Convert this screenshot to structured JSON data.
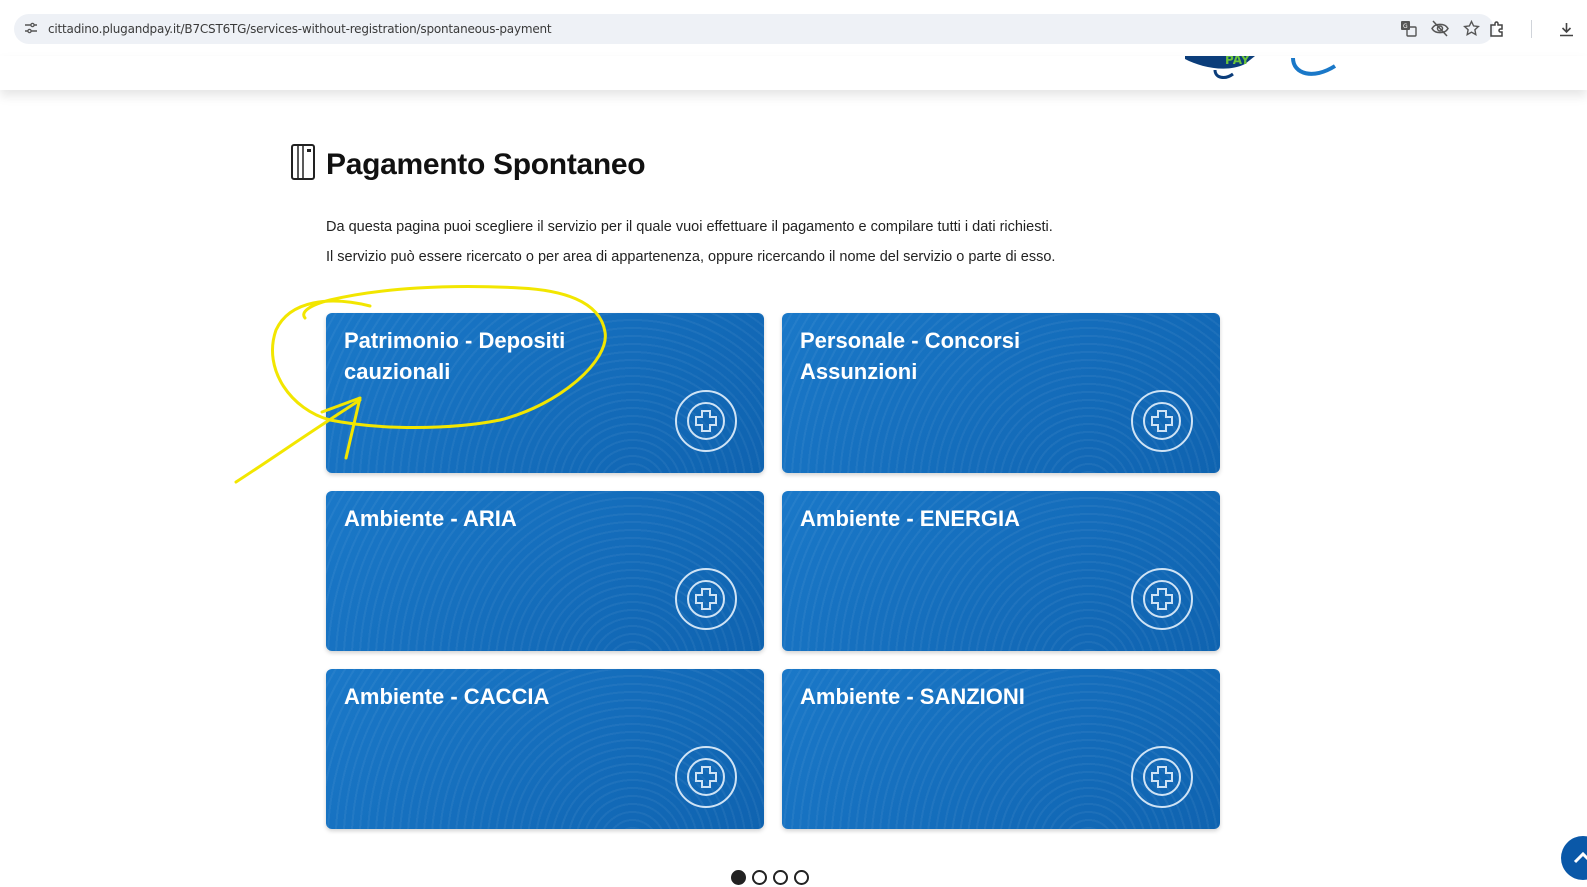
{
  "browser": {
    "url": "cittadino.plugandpay.it/B7CST6TG/services-without-registration/spontaneous-payment",
    "icons": [
      "site-info-icon",
      "translate-icon",
      "eye-off-icon",
      "star-icon",
      "extensions-icon",
      "download-icon"
    ]
  },
  "header": {
    "logo_text": "PAY"
  },
  "main": {
    "title": "Pagamento Spontaneo",
    "intro_line1": "Da questa pagina puoi scegliere il servizio per il quale vuoi effettuare il pagamento e compilare tutti i dati richiesti.",
    "intro_line2": "Il servizio può essere ricercato o per area di appartenenza, oppure ricercando il nome del servizio o parte di esso.",
    "cards": [
      {
        "label": "Patrimonio - Depositi cauzionali"
      },
      {
        "label": "Personale - Concorsi Assunzioni"
      },
      {
        "label": "Ambiente - ARIA"
      },
      {
        "label": "Ambiente - ENERGIA"
      },
      {
        "label": "Ambiente - CACCIA"
      },
      {
        "label": "Ambiente - SANZIONI"
      }
    ]
  },
  "pagination": {
    "pages": 4,
    "current": 1
  },
  "colors": {
    "card_blue": "#1a78c8",
    "annotation_yellow": "#f2e600",
    "scroll_button": "#0a58a8"
  }
}
